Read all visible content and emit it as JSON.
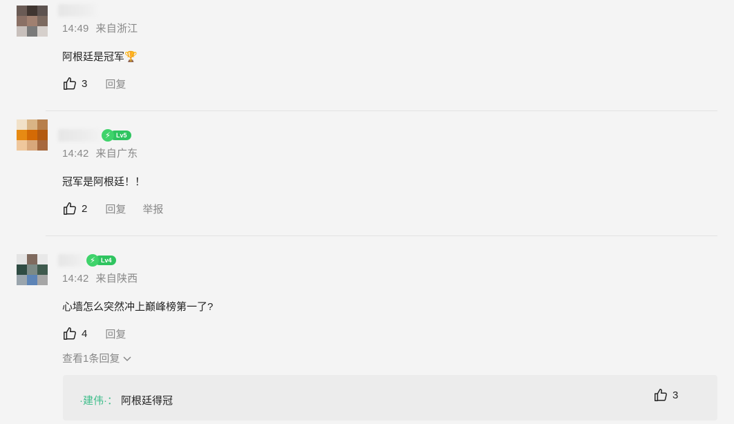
{
  "comments": [
    {
      "time": "14:49",
      "location": "来自浙江",
      "text": "阿根廷是冠军🏆",
      "likes": "3",
      "reply_label": "回复",
      "avatar_colors": [
        "#6a5b55",
        "#3f3530",
        "#5d5350",
        "#8a7065",
        "#a08070",
        "#7c6a60",
        "#c8c0bc",
        "#7a7a7a",
        "#d6d0cc"
      ]
    },
    {
      "time": "14:42",
      "location": "来自广东",
      "text": "冠军是阿根廷！！",
      "likes": "2",
      "reply_label": "回复",
      "report_label": "举报",
      "level": "Lv5",
      "avatar_colors": [
        "#f1e1c8",
        "#d9b485",
        "#b77f4b",
        "#e78a13",
        "#d46a05",
        "#b35a10",
        "#efc79c",
        "#d8a77b",
        "#a7693f"
      ]
    },
    {
      "time": "14:42",
      "location": "来自陕西",
      "text": "心墙怎么突然冲上巅峰榜第一了?",
      "likes": "4",
      "reply_label": "回复",
      "level": "Lv4",
      "view_replies": "查看1条回复",
      "avatar_colors": [
        "#e4e4e4",
        "#7f6a5e",
        "#e8e8e8",
        "#2f4c43",
        "#7c8a86",
        "#3f5a4e",
        "#9aa5ad",
        "#5d84b6",
        "#a6a6a6"
      ]
    }
  ],
  "reply": {
    "author": "·建伟·：",
    "text": "阿根廷得冠",
    "likes": "3"
  },
  "icons": {
    "like": "thumbs-up-icon",
    "expand": "chevron-down-icon",
    "level": "lightning-icon"
  },
  "colors": {
    "accent_green": "#2fc460",
    "reply_author": "#3dbd8a"
  }
}
